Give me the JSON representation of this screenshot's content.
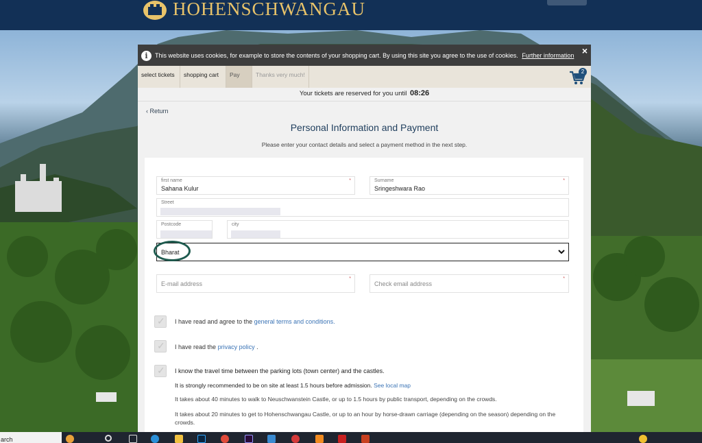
{
  "header": {
    "brand": "HOHENSCHWANGAU"
  },
  "cookie_bar": {
    "message": "This website uses cookies, for example to store the contents of your shopping cart. By using this site you agree to the use of cookies.",
    "link": "Further information",
    "close": "×"
  },
  "steps": [
    {
      "label": "select tickets"
    },
    {
      "label": "shopping cart"
    },
    {
      "label": "Pay"
    },
    {
      "label": "Thanks very much!"
    }
  ],
  "cart": {
    "count": "2"
  },
  "reservation": {
    "text": "Your tickets are reserved for you until",
    "time": "08:26"
  },
  "nav": {
    "back": "‹ Return"
  },
  "page": {
    "title": "Personal Information and Payment",
    "subtitle": "Please enter your contact details and select a payment method in the next step."
  },
  "form": {
    "first_name_label": "first name",
    "first_name_value": "Sahana Kulur",
    "surname_label": "Surname",
    "surname_value": "Sringeshwara Rao",
    "street_label": "Street",
    "postcode_label": "Postcode",
    "city_label": "city",
    "country_value": "Bharat",
    "email_placeholder": "E-mail address",
    "email_check_placeholder": "Check email address",
    "required_mark": "*"
  },
  "consents": {
    "terms_prefix": "I have read and agree to the",
    "terms_link": "general terms and conditions.",
    "privacy_prefix": "I have read the",
    "privacy_link": "privacy policy",
    "privacy_suffix": ".",
    "travel_text": "I know the travel time between the parking lots (town center) and the castles.",
    "recommend_text": "It is strongly recommended to be on site at least 1.5 hours before admission.",
    "map_link": "See local map",
    "neuschwanstein_note": "It takes about 40 minutes to walk to Neuschwanstein Castle, or up to 1.5 hours by public transport, depending on the crowds.",
    "hohenschwangau_note": "It takes about 20 minutes to get to Hohenschwangau Castle, or up to an hour by horse-drawn carriage (depending on the season) depending on the crowds."
  },
  "taskbar": {
    "search": "arch"
  },
  "colors": {
    "header": "#123056",
    "brand": "#e8c36a",
    "link": "#3a73b5",
    "title": "#1e3d5c",
    "mark": "#1f5b4f"
  }
}
